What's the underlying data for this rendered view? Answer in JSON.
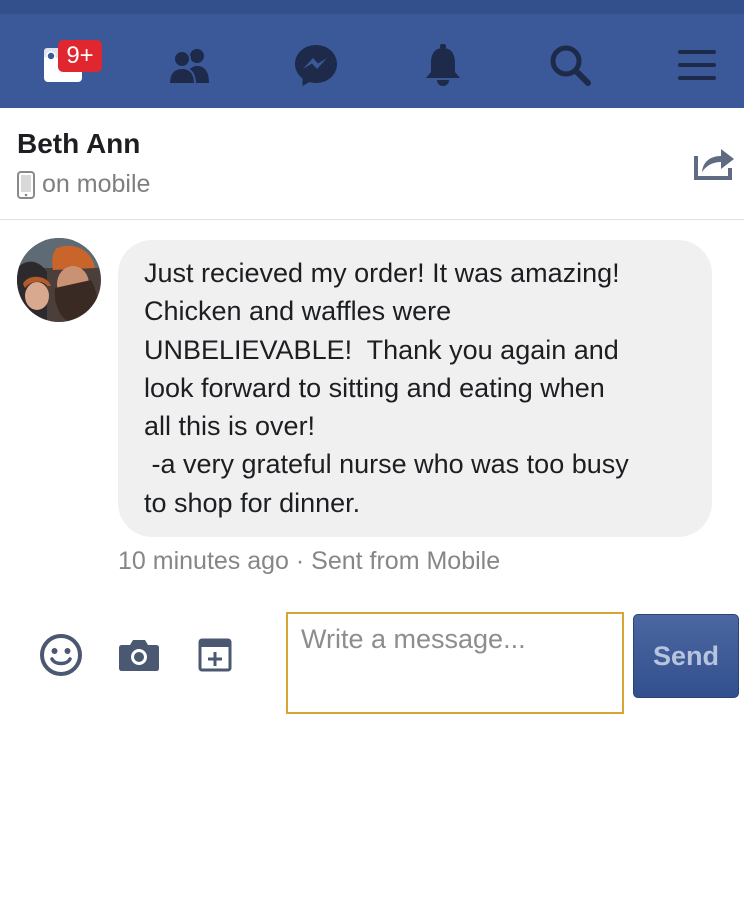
{
  "nav": {
    "icons": [
      "home-feed-icon",
      "friends-icon",
      "messenger-icon",
      "bell-icon",
      "search-icon",
      "menu-icon"
    ],
    "notification_badge": "9+",
    "colors": {
      "bar": "#3b5998",
      "badge": "#e0262e",
      "icon": "#1d2a4a"
    }
  },
  "conversation": {
    "contact_name": "Beth Ann",
    "status": "on mobile",
    "status_icon": "mobile-phone-icon",
    "share_icon": "share-icon"
  },
  "message": {
    "text": "Just recieved my order! It was amazing!\nChicken and waffles were\nUNBELIEVABLE!  Thank you again and\nlook forward to sitting and eating when\nall this is over!\n -a very grateful nurse who was too busy\nto shop for dinner.",
    "meta": "10 minutes ago · Sent from Mobile",
    "avatar_icon": "avatar"
  },
  "composer": {
    "tools": [
      "emoji-icon",
      "camera-icon",
      "sticker-add-icon"
    ],
    "placeholder": "Write a message...",
    "send_label": "Send",
    "colors": {
      "input_border": "#d8a533",
      "send_bg": "#3b5998"
    }
  }
}
